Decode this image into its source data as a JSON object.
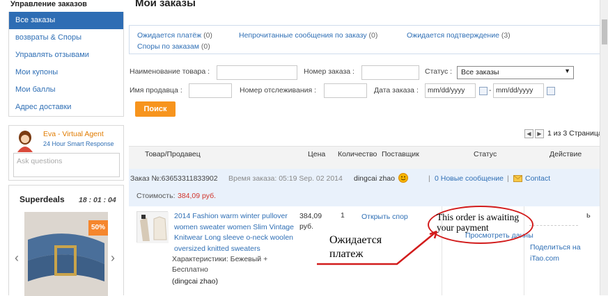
{
  "sidebar": {
    "heading": "Управление заказов",
    "items": [
      {
        "label": "Все заказы",
        "active": true
      },
      {
        "label": "возвраты & Споры"
      },
      {
        "label": "Управлять отзывами"
      },
      {
        "label": "Мои купоны"
      },
      {
        "label": "Мои баллы"
      },
      {
        "label": "Адрес доставки"
      }
    ],
    "agent": {
      "name": "Eva - Virtual Agent",
      "subtitle": "24 Hour Smart Response",
      "placeholder": "Ask questions"
    },
    "superdeals": {
      "title": "Superdeals",
      "timer": "18 : 01 : 04",
      "badge": "50%"
    }
  },
  "page": {
    "title": "Мои заказы"
  },
  "status_links": [
    {
      "label": "Ожидается платёж",
      "count": "(0)"
    },
    {
      "label": "Непрочитанные сообщения по заказу",
      "count": "(0)"
    },
    {
      "label": "Ожидается подтверждение",
      "count": "(3)"
    },
    {
      "label": "Споры по заказам",
      "count": "(0)"
    }
  ],
  "filters": {
    "product_name": "Наименование товара :",
    "order_number": "Номер заказа :",
    "status": "Статус :",
    "status_value": "Все заказы",
    "seller_name": "Имя продавца :",
    "tracking": "Номер отслеживания :",
    "order_date": "Дата заказа :",
    "date_from": "mm/dd/yyyy",
    "date_to": "mm/dd/yyyy",
    "date_sep": "-",
    "search_label": "Поиск"
  },
  "pager": {
    "text": "1 из 3 Страница"
  },
  "table": {
    "headers": {
      "product": "Товар/Продавец",
      "price": "Цена",
      "qty": "Количество",
      "supplier": "Поставщик",
      "status": "Статус",
      "action": "Действие"
    }
  },
  "order": {
    "number": "Заказ №:63653311833902",
    "time": "Время заказа: 05:19 Sep. 02 2014",
    "seller": "dingcai zhao",
    "messages": "0 Новые сообщение",
    "contact": "Contact",
    "cost_label": "Стоимость:",
    "cost_value": "384,09 руб.",
    "item_title": "2014 Fashion warm winter pullover women sweater women Slim Vintage Knitwear Long sleeve o-neck woolen oversized knitted sweaters",
    "attrs": "Характеристики: Бежевый + Бесплатно",
    "seller_paren": "(dingcai zhao)",
    "price": "384,09",
    "price_unit": "руб.",
    "qty": "1",
    "dispute": "Открыть спор",
    "status_partial": "Просмотреть данны",
    "action_partial": "ь",
    "share": "Поделиться на",
    "share_site": "iTao.com"
  },
  "annotations": {
    "oval_text": "This order is awaiting your payment",
    "pointer_text": "Ожидается платеж"
  }
}
